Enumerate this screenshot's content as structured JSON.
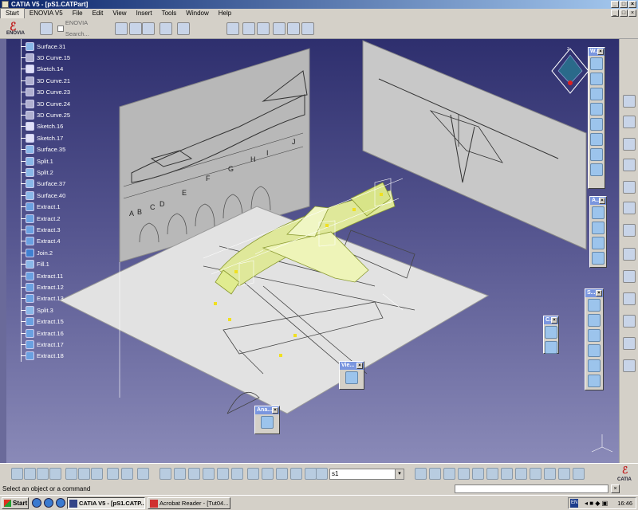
{
  "window": {
    "title": "CATIA V5 - [pS1.CATPart]",
    "min": "_",
    "max": "□",
    "close": "×"
  },
  "menu": [
    "Start",
    "ENOVIA V5",
    "File",
    "Edit",
    "View",
    "Insert",
    "Tools",
    "Window",
    "Help"
  ],
  "toolbar_top": {
    "enovia_label": "ENOVIA",
    "enovia_search": "ENOVIA Search..."
  },
  "tree": [
    {
      "label": "Surface.31",
      "icon": "surface-icon"
    },
    {
      "label": "3D Curve.15",
      "icon": "curve-icon"
    },
    {
      "label": "Sketch.14",
      "icon": "sketch-icon"
    },
    {
      "label": "3D Curve.21",
      "icon": "curve-icon"
    },
    {
      "label": "3D Curve.23",
      "icon": "curve-icon"
    },
    {
      "label": "3D Curve.24",
      "icon": "curve-icon"
    },
    {
      "label": "3D Curve.25",
      "icon": "curve-icon"
    },
    {
      "label": "Sketch.16",
      "icon": "sketch-icon"
    },
    {
      "label": "Sketch.17",
      "icon": "sketch-icon"
    },
    {
      "label": "Surface.35",
      "icon": "surface-icon"
    },
    {
      "label": "Split.1",
      "icon": "split-icon"
    },
    {
      "label": "Split.2",
      "icon": "split-icon"
    },
    {
      "label": "Surface.37",
      "icon": "surface-icon"
    },
    {
      "label": "Surface.40",
      "icon": "surface-icon"
    },
    {
      "label": "Extract.1",
      "icon": "extract-icon"
    },
    {
      "label": "Extract.2",
      "icon": "extract-icon"
    },
    {
      "label": "Extract.3",
      "icon": "extract-icon"
    },
    {
      "label": "Extract.4",
      "icon": "extract-icon"
    },
    {
      "label": "Join.2",
      "icon": "join-icon"
    },
    {
      "label": "Fill.1",
      "icon": "fill-icon"
    },
    {
      "label": "Extract.11",
      "icon": "extract-icon"
    },
    {
      "label": "Extract.12",
      "icon": "extract-icon"
    },
    {
      "label": "Extract.13",
      "icon": "extract-icon"
    },
    {
      "label": "Split.3",
      "icon": "split-icon"
    },
    {
      "label": "Extract.15",
      "icon": "extract-icon"
    },
    {
      "label": "Extract.16",
      "icon": "extract-icon"
    },
    {
      "label": "Extract.17",
      "icon": "extract-icon"
    },
    {
      "label": "Extract.18",
      "icon": "extract-icon"
    }
  ],
  "panels": {
    "wireframe": {
      "title": "W..."
    },
    "analysis_right": {
      "title": "A..."
    },
    "surfaces": {
      "title": "S..."
    },
    "constraints": {
      "title": "C..."
    },
    "view": {
      "title": "Vie..."
    },
    "analysis": {
      "title": "Ana..."
    }
  },
  "blueprint_letters": [
    "A",
    "B",
    "C",
    "D",
    "E",
    "F",
    "G",
    "H",
    "I",
    "J"
  ],
  "bottom_toolbar": {
    "combo_value": "s1",
    "catia_label": "CATIA"
  },
  "status": {
    "message": "Select an object or a command"
  },
  "taskbar": {
    "start": "Start",
    "tasks": [
      "CATIA V5 - [pS1.CATP...",
      "Acrobat Reader - [Tut04..."
    ],
    "lang": "EN",
    "clock": "16:46"
  },
  "colors": {
    "viewport_top": "#2e2f6e",
    "viewport_bottom": "#8a8ab8",
    "surface_highlight": "#e8f0a0",
    "titlebar": "#0a246a"
  }
}
